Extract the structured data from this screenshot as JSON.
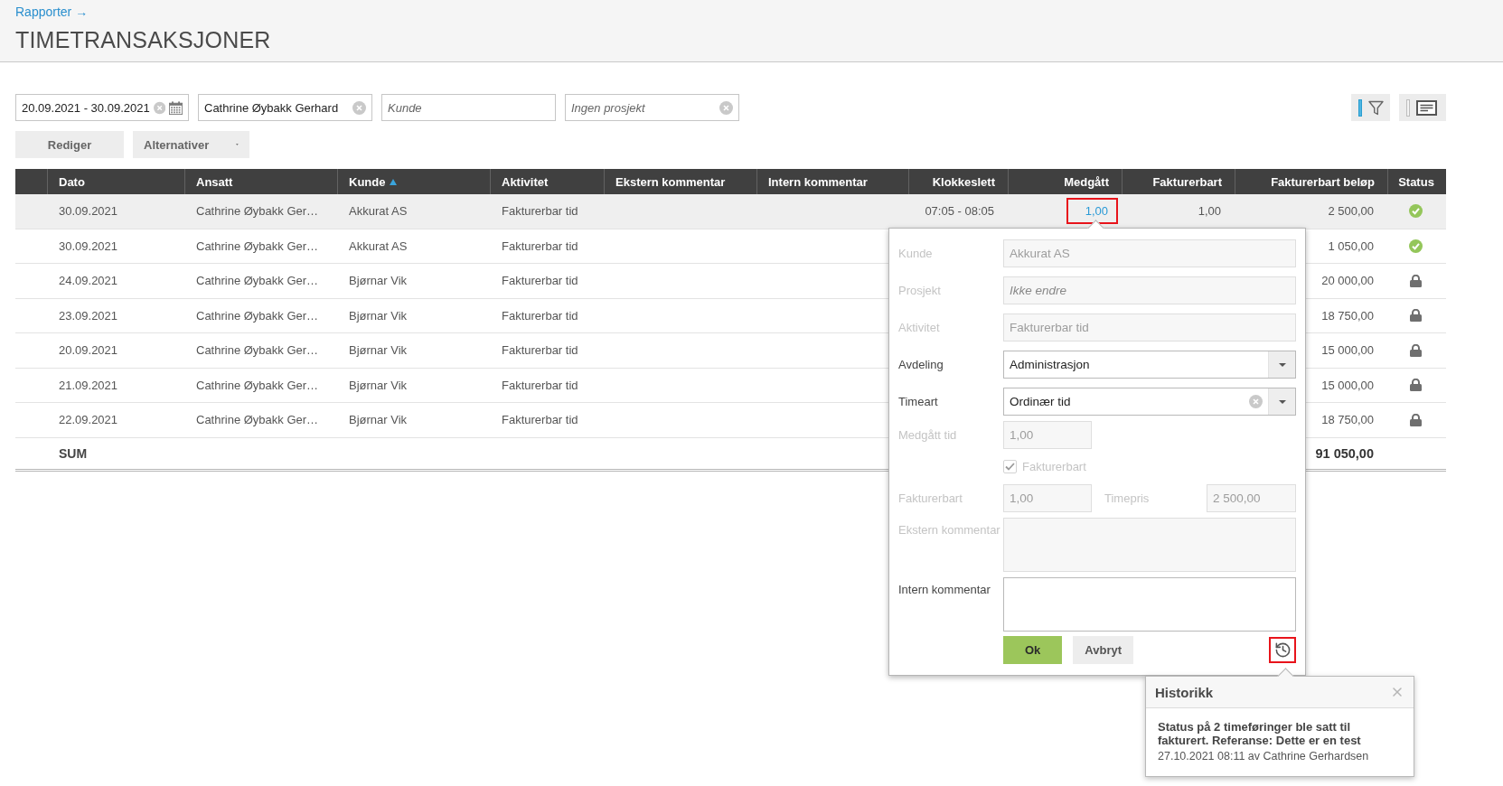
{
  "breadcrumb": {
    "label": "Rapporter →"
  },
  "title": "TIMETRANSAKSJONER",
  "filters": [
    {
      "kind": "date",
      "value": "20.09.2021 - 30.09.2021",
      "clearable": true
    },
    {
      "kind": "text",
      "value": "Cathrine Øybakk Gerhard",
      "clearable": true
    },
    {
      "kind": "text",
      "placeholder": "Kunde",
      "clearable": false
    },
    {
      "kind": "text",
      "placeholder": "Ingen prosjekt",
      "clearable": true
    }
  ],
  "toggles": [
    {
      "kind": "filter",
      "active": true
    },
    {
      "kind": "comments",
      "active": false
    }
  ],
  "actions": [
    {
      "kind": "plain",
      "label": "Rediger"
    },
    {
      "kind": "dropdown",
      "label": "Alternativer"
    }
  ],
  "table": {
    "columns": [
      {
        "label": "Dato",
        "kind": "text",
        "sorted": false
      },
      {
        "label": "Ansatt",
        "kind": "text",
        "sorted": false
      },
      {
        "label": "Kunde",
        "kind": "text",
        "sorted": true
      },
      {
        "label": "Aktivitet",
        "kind": "text",
        "sorted": false
      },
      {
        "label": "Ekstern kommentar",
        "kind": "text",
        "sorted": false
      },
      {
        "label": "Intern kommentar",
        "kind": "text",
        "sorted": false
      },
      {
        "label": "Klokkeslett",
        "kind": "number",
        "sorted": false
      },
      {
        "label": "Medgått",
        "kind": "link",
        "sorted": false
      },
      {
        "label": "Fakturerbart",
        "kind": "number",
        "sorted": false
      },
      {
        "label": "Fakturerbart beløp",
        "kind": "number",
        "sorted": false
      },
      {
        "label": "Status",
        "kind": "status",
        "sorted": false
      }
    ],
    "rows": [
      {
        "selected": true,
        "date": "30.09.2021",
        "employee": "Cathrine Øybakk Ger…",
        "customer": "Akkurat AS",
        "activity": "Fakturerbar tid",
        "time": "07:05 - 08:05",
        "duration": "1,00",
        "duration_highlighted": true,
        "billable": "1,00",
        "amount": "2 500,00",
        "locked": false
      },
      {
        "selected": false,
        "date": "30.09.2021",
        "employee": "Cathrine Øybakk Ger…",
        "customer": "Akkurat AS",
        "activity": "Fakturerbar tid",
        "amount": "1 050,00",
        "locked": false
      },
      {
        "selected": false,
        "date": "24.09.2021",
        "employee": "Cathrine Øybakk Ger…",
        "customer": "Bjørnar Vik",
        "activity": "Fakturerbar tid",
        "amount": "20 000,00",
        "locked": true
      },
      {
        "selected": false,
        "date": "23.09.2021",
        "employee": "Cathrine Øybakk Ger…",
        "customer": "Bjørnar Vik",
        "activity": "Fakturerbar tid",
        "amount": "18 750,00",
        "locked": true
      },
      {
        "selected": false,
        "date": "20.09.2021",
        "employee": "Cathrine Øybakk Ger…",
        "customer": "Bjørnar Vik",
        "activity": "Fakturerbar tid",
        "amount": "15 000,00",
        "locked": true
      },
      {
        "selected": false,
        "date": "21.09.2021",
        "employee": "Cathrine Øybakk Ger…",
        "customer": "Bjørnar Vik",
        "activity": "Fakturerbar tid",
        "amount": "15 000,00",
        "locked": true
      },
      {
        "selected": false,
        "date": "22.09.2021",
        "employee": "Cathrine Øybakk Ger…",
        "customer": "Bjørnar Vik",
        "activity": "Fakturerbar tid",
        "amount": "18 750,00",
        "locked": true
      }
    ],
    "sum": {
      "label": "SUM",
      "amount": "91 050,00"
    }
  },
  "editor": {
    "fields": [
      {
        "kind": "text",
        "label": "Kunde",
        "value": "Akkurat AS",
        "disabled": true
      },
      {
        "kind": "text",
        "label": "Prosjekt",
        "placeholder": "Ikke endre",
        "disabled": true
      },
      {
        "kind": "text",
        "label": "Aktivitet",
        "value": "Fakturerbar tid",
        "disabled": true
      },
      {
        "kind": "select",
        "label": "Avdeling",
        "value": "Administrasjon",
        "clearable": false,
        "disabled": false
      },
      {
        "kind": "select",
        "label": "Timeart",
        "value": "Ordinær tid",
        "clearable": true,
        "disabled": false
      },
      {
        "kind": "short",
        "label": "Medgått tid",
        "value": "1,00",
        "disabled": true
      },
      {
        "kind": "checkbox",
        "label": "Fakturerbart",
        "checked": true,
        "disabled": true
      },
      {
        "kind": "pair",
        "label": "Fakturerbart",
        "value": "1,00",
        "label_2": "Timepris",
        "value_2": "2 500,00",
        "disabled": true
      },
      {
        "kind": "textarea",
        "label": "Ekstern kommentar",
        "disabled": true
      },
      {
        "kind": "textarea",
        "label": "Intern kommentar",
        "disabled": false
      }
    ],
    "buttons": [
      {
        "kind": "primary",
        "label": "Ok"
      },
      {
        "kind": "secondary",
        "label": "Avbryt"
      }
    ],
    "history_button": {
      "highlighted": true
    }
  },
  "history": {
    "title": "Historikk",
    "entries": [
      {
        "text": "Status på 2 timeføringer ble satt til fakturert. Referanse: Dette er en test",
        "meta": "27.10.2021 08:11 av Cathrine Gerhardsen"
      }
    ]
  }
}
